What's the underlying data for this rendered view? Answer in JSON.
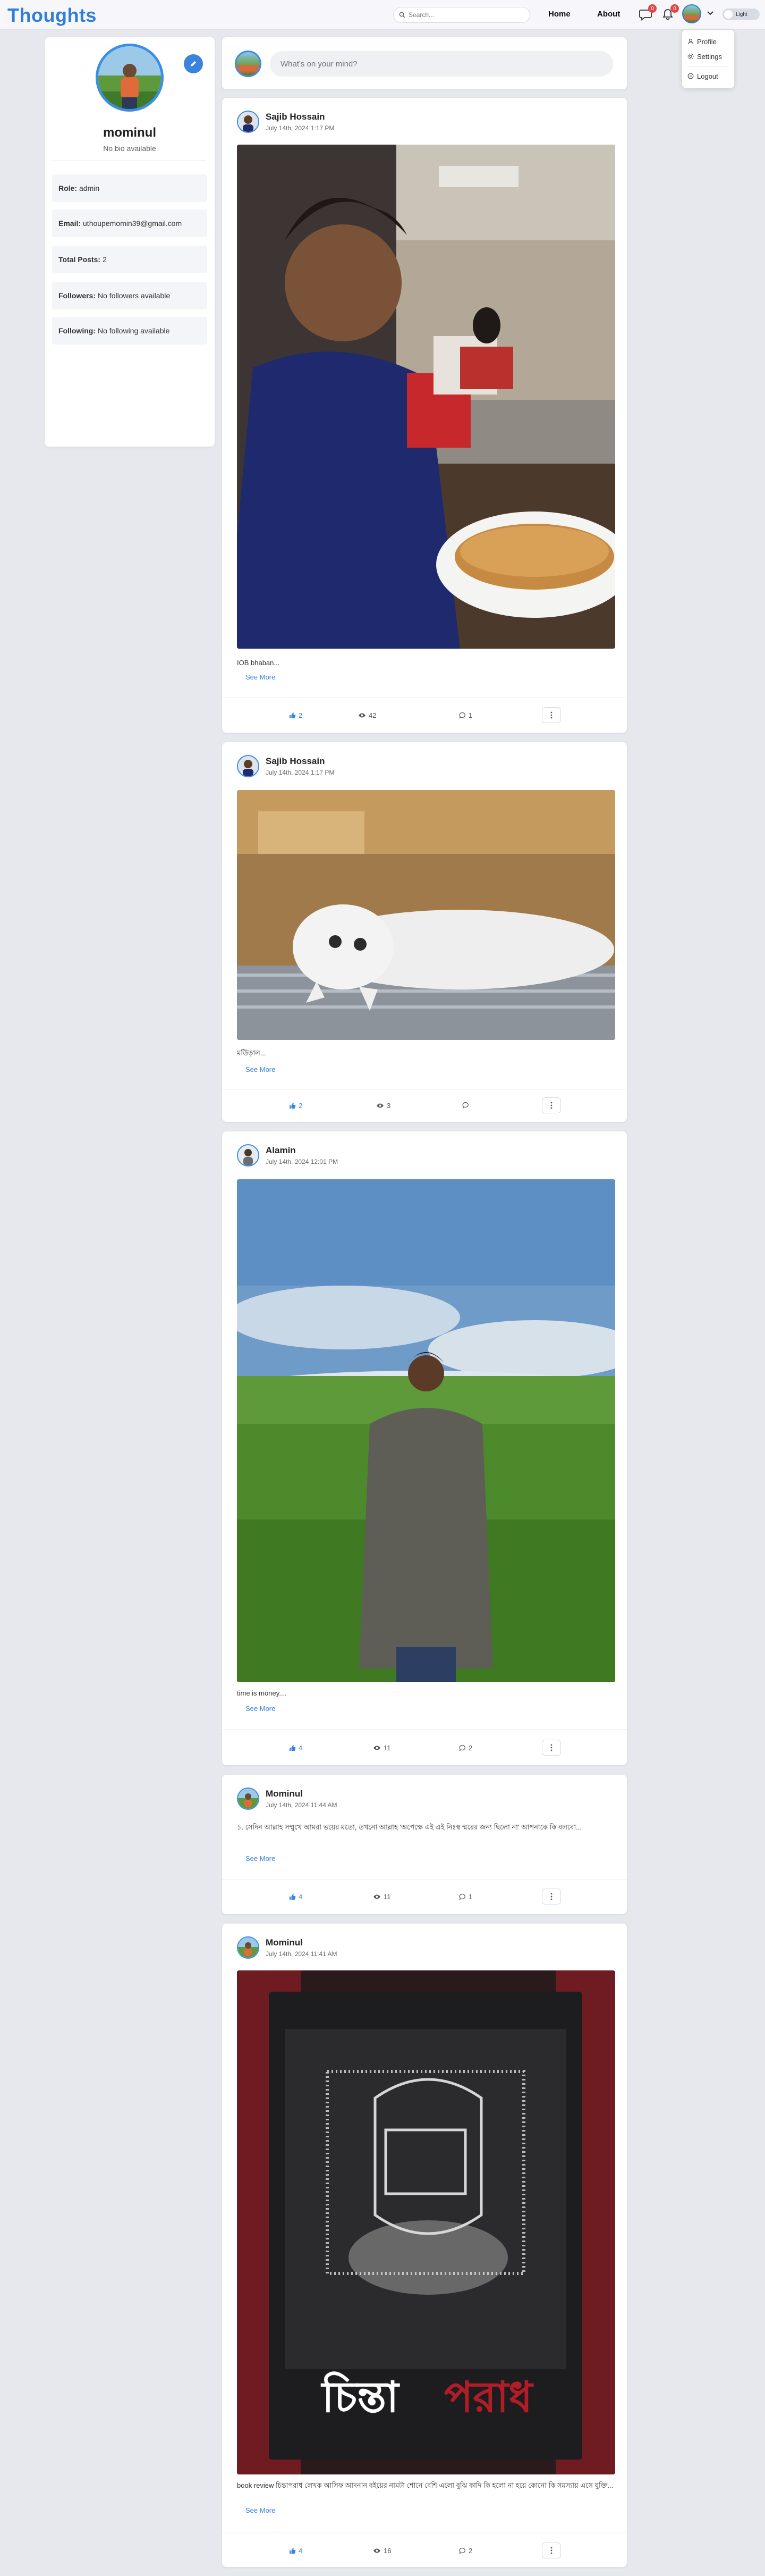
{
  "app": {
    "title": "Thoughts"
  },
  "colors": {
    "accent": "#2f7fd8",
    "like": "#3a84e0",
    "badge": "#e04848"
  },
  "search": {
    "placeholder": "Search..."
  },
  "nav": {
    "home": "Home",
    "about": "About",
    "messages_icon": "chat-icon",
    "messages_count": "0",
    "notifications_icon": "bell-icon",
    "notifications_count": "0",
    "theme_toggle_label": "Light"
  },
  "dropdown": {
    "profile": "Profile",
    "settings": "Settings",
    "logout": "Logout"
  },
  "profile": {
    "name": "mominul",
    "bio": "No bio available",
    "fields": [
      {
        "label": "Role:",
        "value": "admin"
      },
      {
        "label": "Email:",
        "value": "uthoupemomin39@gmail.com"
      },
      {
        "label": "Total Posts:",
        "value": "2"
      },
      {
        "label": "Followers:",
        "value": "No followers available"
      },
      {
        "label": "Following:",
        "value": "No following available"
      }
    ]
  },
  "compose": {
    "placeholder": "What's on your mind?"
  },
  "posts": [
    {
      "author": "Sajib Hossain",
      "date": "July 14th, 2024 1:17 PM",
      "text": "IOB bhaban...",
      "see_more": "See More",
      "likes": "2",
      "views": "42",
      "comments": "1"
    },
    {
      "author": "Sajib Hossain",
      "date": "July 14th, 2024 1:17 PM",
      "text": "মউিড়াল...",
      "see_more": "See More",
      "likes": "2",
      "views": "3",
      "comments": ""
    },
    {
      "author": "Alamin",
      "date": "July 14th, 2024 12:01 PM",
      "text": "time is money....",
      "see_more": "See More",
      "likes": "4",
      "views": "11",
      "comments": "2"
    },
    {
      "author": "Mominul",
      "date": "July 14th, 2024 11:44 AM",
      "text": "১. সেদিন আল্লাহ সম্মুখে আমরা ভয়ের মতো, তখনো আল্লাহ 'অপেক্ষে এই এই নিঃস্ব ম্মরের জন্য ছিলো না' আপনাকে কি বলবো...",
      "see_more": "See More",
      "likes": "4",
      "views": "11",
      "comments": "1"
    },
    {
      "author": "Mominul",
      "date": "July 14th, 2024 11:41 AM",
      "text": "book review চিন্তাপরাধ লেখক আসিফ আদনান বইয়ের নামটা শোনে বেশি এলো বুঝি কাদি কি হলো না হয়ে কোনো কি সমস্যায় এসে যুক্তি...",
      "see_more": "See More",
      "likes": "4",
      "views": "16",
      "comments": "2"
    }
  ]
}
